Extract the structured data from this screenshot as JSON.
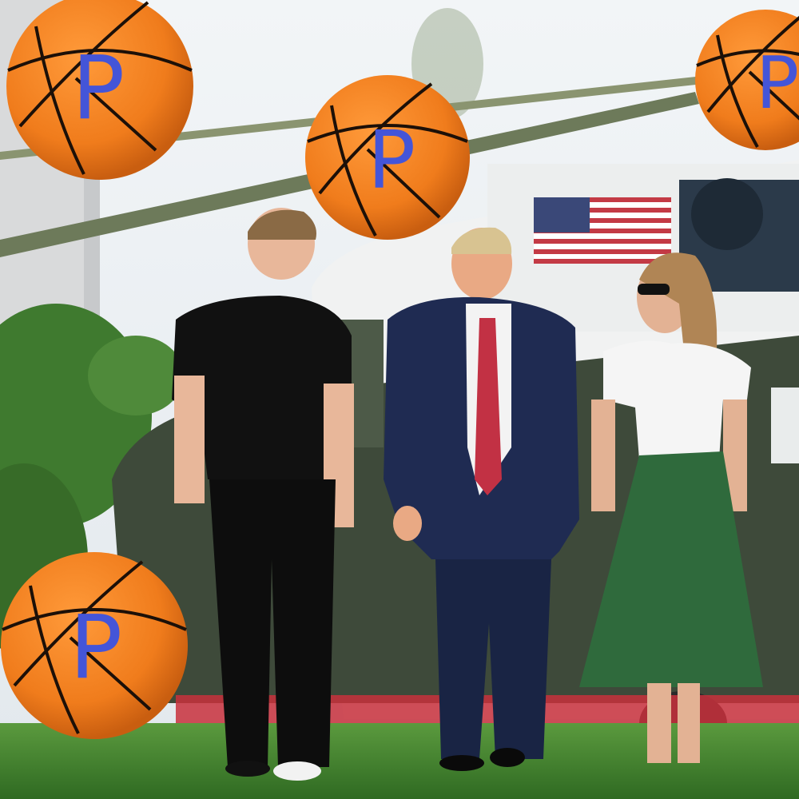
{
  "scene": {
    "description_hidden": "",
    "colors": {
      "sky": "#eef2f5",
      "grass": "#3f7f2c",
      "helicopter_top": "#f2f3f3",
      "helicopter_bottom": "#3d4a38",
      "ball_orange": "#f07c1c",
      "ball_letter": "#4455d8"
    }
  },
  "balls": [
    {
      "letter": "P"
    },
    {
      "letter": "P"
    },
    {
      "letter": "P"
    },
    {
      "letter": "P"
    }
  ]
}
